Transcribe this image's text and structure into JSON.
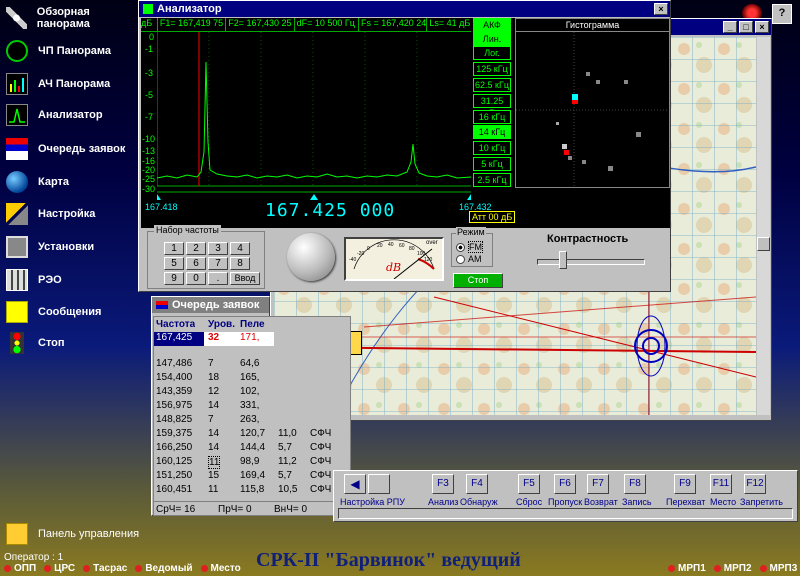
{
  "sidebar": {
    "items": [
      {
        "label": "Обзорная панорама",
        "icon": "satellite-icon"
      },
      {
        "label": "ЧП Панорама",
        "icon": "radar-icon"
      },
      {
        "label": "АЧ Панорама",
        "icon": "bars-icon"
      },
      {
        "label": "Анализатор",
        "icon": "analyzer-icon"
      },
      {
        "label": "Очередь заявок",
        "icon": "queue-icon"
      },
      {
        "label": "Карта",
        "icon": "globe-icon"
      },
      {
        "label": "Настройка",
        "icon": "tools-icon"
      },
      {
        "label": "Установки",
        "icon": "settings-icon"
      },
      {
        "label": "РЭО",
        "icon": "calculator-icon"
      },
      {
        "label": "Сообщения",
        "icon": "envelope-icon"
      },
      {
        "label": "Стоп",
        "icon": "traffic-light-icon"
      }
    ],
    "control_panel": "Панель управления"
  },
  "analyzer": {
    "title": "Анализатор",
    "readouts": [
      "дБ",
      "F1= 167,419 75",
      "F2= 167,430 25",
      "dF= 10 500 Гц",
      "Fs = 167,420 24",
      "Ls= 41 дБ"
    ],
    "yticks": [
      "0",
      "-1",
      "-3",
      "-5",
      "-7",
      "-10",
      "-13",
      "-16",
      "-20",
      "-25",
      "-30"
    ],
    "freq_left": "167.418",
    "freq_right": "167.432",
    "freq_center": "167.425 000",
    "att": "Атт 00 дБ",
    "bw_items": [
      "АКФ",
      "Лин.",
      "Лог.",
      "125 кГц",
      "62.5 кГц",
      "31.25 кГц",
      "16 кГц",
      "14 кГц",
      "10 кГц",
      "5 кГц",
      "2.5 кГц"
    ],
    "histogram_title": "Гистограмма",
    "keypad_title": "Набор частоты",
    "keys": [
      "1",
      "2",
      "3",
      "4",
      "5",
      "6",
      "7",
      "8",
      "9",
      "0",
      ".",
      "Ввод"
    ],
    "meter_label": "dB",
    "meter_scale": [
      "-40",
      "-20",
      "0",
      "20",
      "40",
      "60",
      "80",
      "100",
      "120"
    ],
    "meter_over": "over",
    "mode_title": "Режим",
    "mode_fm": "FM",
    "mode_am": "AM",
    "stop_label": "Стоп",
    "contrast_label": "Контрастность"
  },
  "queue": {
    "title": "Очередь заявок",
    "headers": [
      "Частота",
      "Уров.",
      "Пеле"
    ],
    "selected": [
      "167,425",
      "32",
      "171,"
    ],
    "rows": [
      [
        "147,486",
        "7",
        "64,6",
        "",
        ""
      ],
      [
        "154,400",
        "18",
        "165,",
        "",
        ""
      ],
      [
        "143,359",
        "12",
        "102,",
        "",
        ""
      ],
      [
        "156,975",
        "14",
        "331,",
        "",
        ""
      ],
      [
        "148,825",
        "7",
        "263,",
        "",
        ""
      ],
      [
        "159,375",
        "14",
        "120,7",
        "11,0",
        "СФЧ"
      ],
      [
        "166,250",
        "14",
        "144,4",
        "5,7",
        "СФЧ"
      ],
      [
        "160,125",
        "11",
        "98,9",
        "11,2",
        "СФЧ"
      ],
      [
        "151,250",
        "15",
        "169,4",
        "5,7",
        "СФЧ"
      ],
      [
        "160,451",
        "11",
        "115,8",
        "10,5",
        "СФЧ"
      ]
    ],
    "footer": [
      "СрЧ= 16",
      "ПрЧ= 0",
      "ВнЧ= 0"
    ]
  },
  "fkeys": {
    "keys": [
      "F3",
      "F4",
      "F5",
      "F6",
      "F7",
      "F8",
      "F9",
      "F11",
      "F12"
    ],
    "labels": [
      "Настройка РПУ",
      "Анализ",
      "Обнаруж",
      "Сброс",
      "Пропуск",
      "Возврат",
      "Запись",
      "Перехват",
      "Место",
      "Запретить"
    ]
  },
  "map": {
    "marker": "S"
  },
  "status": {
    "operator": "Оператор : 1",
    "indicators": [
      "ОПП",
      "ЦРС",
      "Тасрас",
      "Ведомый",
      "Место"
    ],
    "banner": "СРК-II \"Барвинок\" ведущий",
    "right": [
      "МРП1",
      "МРП2",
      "МРП3"
    ]
  },
  "colors": {
    "accent": "#00ff00",
    "titlebar": "#000080",
    "banner": "#10207a",
    "alert": "#e02020"
  }
}
